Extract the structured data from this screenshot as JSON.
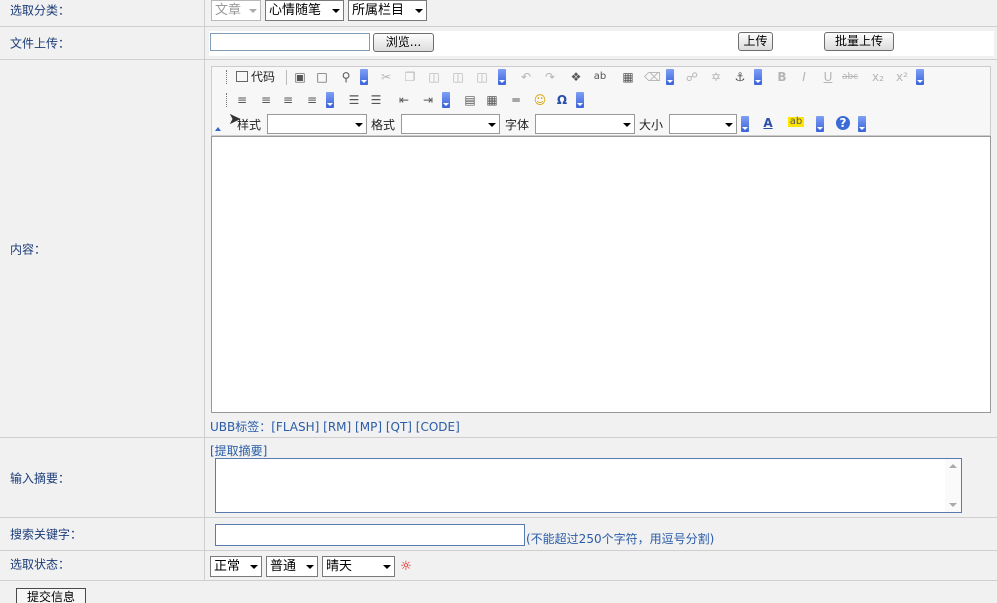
{
  "category": {
    "label": "选取分类：",
    "article": "文章",
    "mood": "心情随笔",
    "column": "所属栏目"
  },
  "upload": {
    "label": "文件上传：",
    "browse": "浏览...",
    "upload_btn": "上传",
    "batch_btn": "批量上传"
  },
  "content": {
    "label": "内容：",
    "toolbar": {
      "code_label": "代码",
      "style_label": "样式",
      "format_label": "格式",
      "font_label": "字体",
      "size_label": "大小"
    },
    "ubb_label": "UBB标签：",
    "ubb_tags": [
      "[FLASH]",
      "[RM]",
      "[MP]",
      "[QT]",
      "[CODE]"
    ]
  },
  "summary": {
    "label": "输入摘要：",
    "extract_link": "[提取摘要]"
  },
  "keywords": {
    "label": "搜索关键字：",
    "hint": "(不能超过250个字符，用逗号分割)"
  },
  "status": {
    "label": "选取状态：",
    "state": "正常",
    "level": "普通",
    "weather": "晴天"
  },
  "submit": {
    "label": "提交信息"
  }
}
